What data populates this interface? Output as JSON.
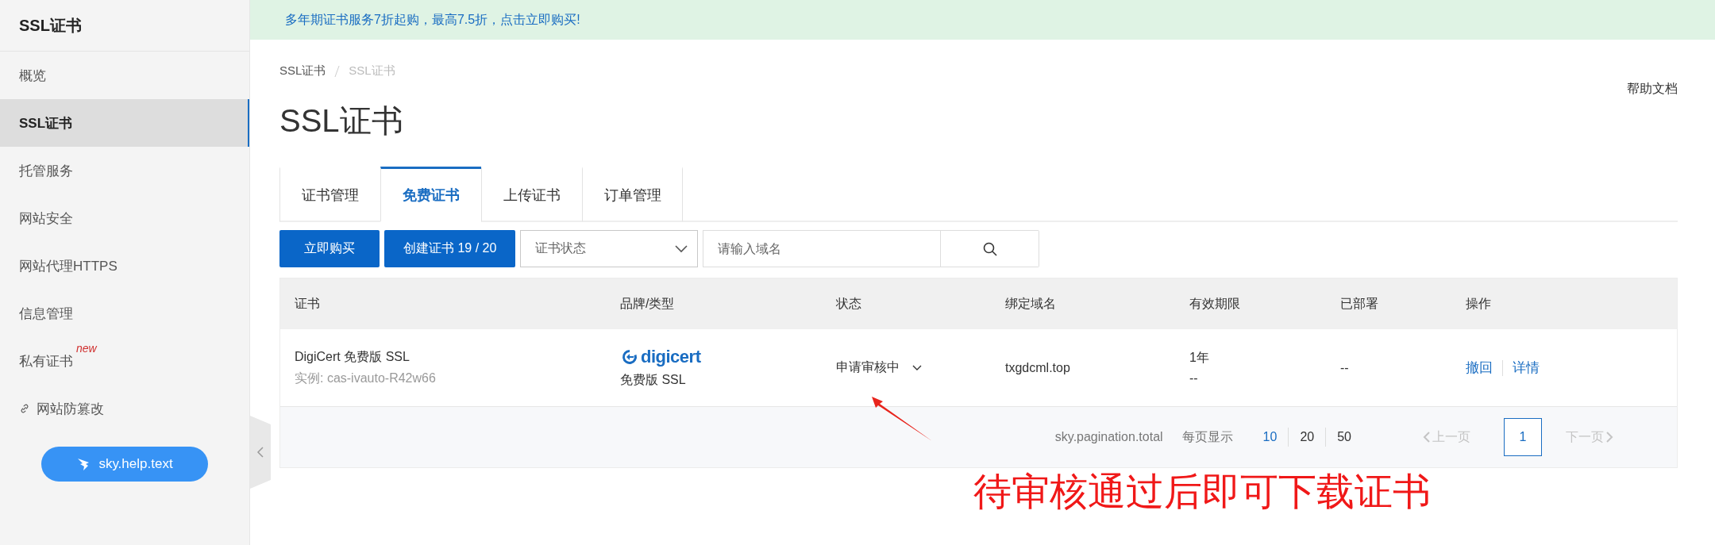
{
  "sidebar": {
    "title": "SSL证书",
    "items": [
      {
        "label": "概览",
        "selected": false,
        "kind": "plain"
      },
      {
        "label": "SSL证书",
        "selected": true,
        "kind": "plain"
      },
      {
        "label": "托管服务",
        "selected": false,
        "kind": "plain"
      },
      {
        "label": "网站安全",
        "selected": false,
        "kind": "plain"
      },
      {
        "label": "网站代理HTTPS",
        "selected": false,
        "kind": "plain"
      },
      {
        "label": "信息管理",
        "selected": false,
        "kind": "plain"
      },
      {
        "label": "私有证书",
        "selected": false,
        "kind": "plain",
        "badge": "new"
      },
      {
        "label": "网站防篡改",
        "selected": false,
        "kind": "link"
      }
    ],
    "help_button": "sky.help.text"
  },
  "banner": "多年期证书服务7折起购，最高7.5折，点击立即购买!",
  "breadcrumb": [
    "SSL证书",
    "SSL证书"
  ],
  "page_title": "SSL证书",
  "help_link": "帮助文档",
  "tabs": [
    {
      "label": "证书管理",
      "selected": false
    },
    {
      "label": "免费证书",
      "selected": true
    },
    {
      "label": "上传证书",
      "selected": false
    },
    {
      "label": "订单管理",
      "selected": false
    }
  ],
  "toolbar": {
    "buy_button": "立即购买",
    "create_button": "创建证书 19 / 20",
    "status_select": {
      "placeholder": "证书状态"
    },
    "search": {
      "placeholder": "请输入域名"
    }
  },
  "table": {
    "columns": [
      "证书",
      "品牌/类型",
      "状态",
      "绑定域名",
      "有效期限",
      "已部署",
      "操作"
    ],
    "rows": [
      {
        "name": "DigiCert 免费版 SSL",
        "instance": "实例: cas-ivauto-R42w66",
        "brand_logo": "digicert",
        "brand_type": "免费版 SSL",
        "status": "申请审核中",
        "domain": "txgdcml.top",
        "validity": "1年",
        "validity_end": "--",
        "deployed": "--",
        "actions": [
          "撤回",
          "详情"
        ]
      }
    ]
  },
  "pagination": {
    "total": "sky.pagination.total",
    "per_page_label": "每页显示",
    "sizes": [
      {
        "label": "10",
        "selected": true
      },
      {
        "label": "20",
        "selected": false
      },
      {
        "label": "50",
        "selected": false
      }
    ],
    "prev": {
      "label": "上一页",
      "disabled": true
    },
    "pages": [
      {
        "label": "1",
        "selected": true
      }
    ],
    "next": {
      "label": "下一页",
      "disabled": true
    }
  },
  "annotation": "待审核通过后即可下载证书"
}
